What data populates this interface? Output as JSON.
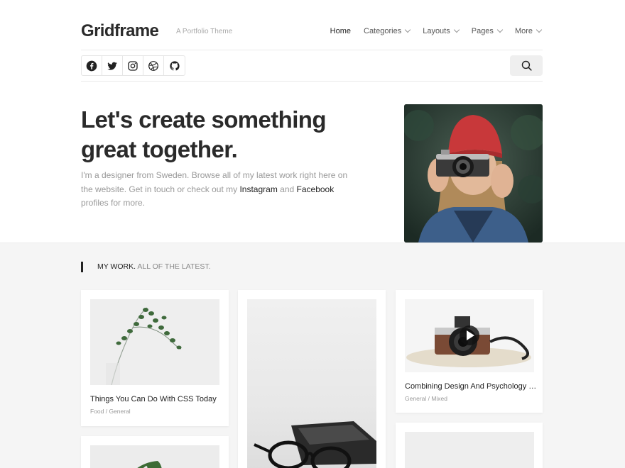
{
  "header": {
    "logo": "Gridframe",
    "tagline": "A Portfolio Theme",
    "nav": [
      {
        "label": "Home"
      },
      {
        "label": "Categories"
      },
      {
        "label": "Layouts"
      },
      {
        "label": "Pages"
      },
      {
        "label": "More"
      }
    ]
  },
  "social": {
    "icons": [
      "facebook-icon",
      "twitter-icon",
      "instagram-icon",
      "dribbble-icon",
      "github-icon"
    ],
    "search_icon": "search-icon"
  },
  "hero": {
    "title_line1": "Let's create something",
    "title_line2": "great together.",
    "text_before": "I'm a designer from Sweden. Browse all of my latest work right here on the website. Get in touch or check out my ",
    "link_instagram": "Instagram",
    "text_and": " and ",
    "link_facebook": "Facebook",
    "text_after": " profiles for more."
  },
  "work": {
    "title_strong": "MY WORK.",
    "title_muted": " ALL OF THE LATEST.",
    "cards": [
      {
        "title": "Things You Can Do With CSS Today",
        "meta": "Food / General"
      },
      {
        "title": "",
        "meta": ""
      },
      {
        "title": "Combining Design And Psychology …",
        "meta": "General / Mixed"
      }
    ]
  },
  "colors": {
    "accent": "#222222",
    "section_bg": "#f5f5f5",
    "muted_text": "#999999"
  }
}
